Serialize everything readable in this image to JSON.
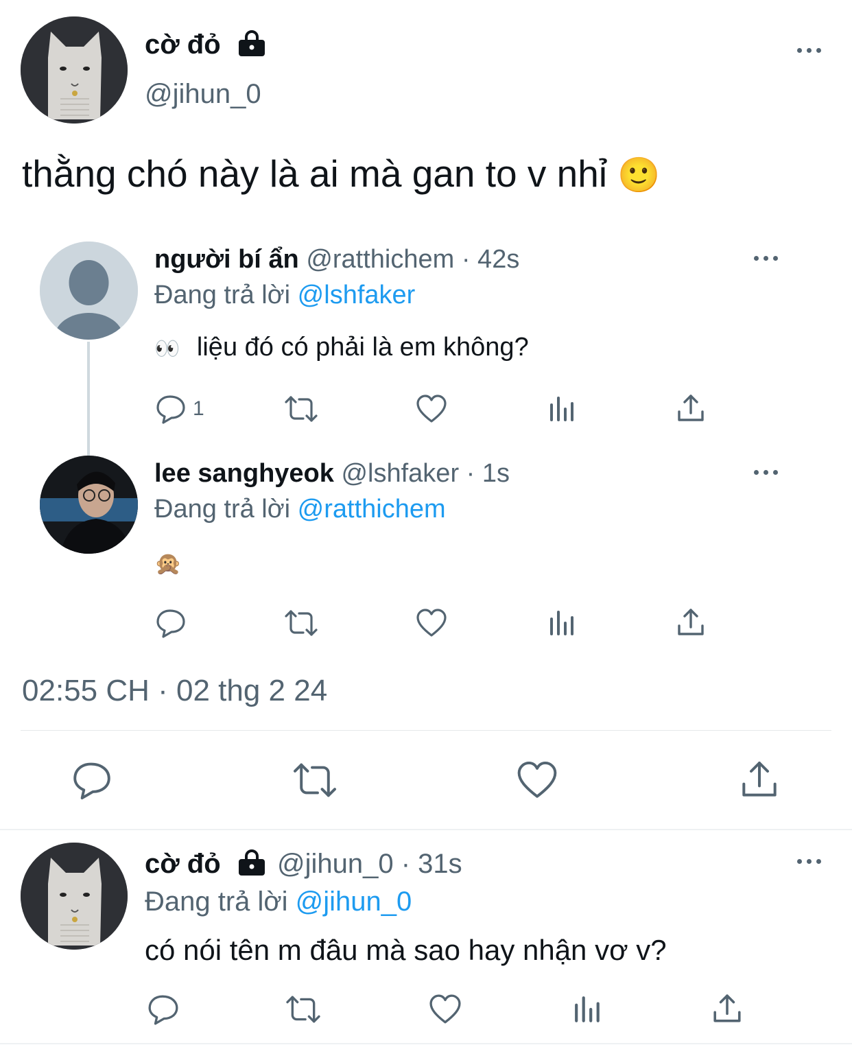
{
  "main_tweet": {
    "display_name": "cờ đỏ",
    "handle": "@jihun_0",
    "text": "thằng chó này là ai mà gan to v nhỉ",
    "emoji": "🙂",
    "timestamp": "02:55 CH · 02 thg 2 24"
  },
  "quoted_thread": [
    {
      "display_name": "người bí ẩn",
      "meta": "@ratthichem · 42s",
      "reply_prefix": "Đang trả lời",
      "reply_to": "@lshfaker",
      "emoji": "👀",
      "text": "liệu đó có phải là em không?",
      "reply_count": "1"
    },
    {
      "display_name": "lee sanghyeok",
      "meta": "@lshfaker · 1s",
      "reply_prefix": "Đang trả lời",
      "reply_to": "@ratthichem",
      "emoji": "🙊",
      "text": "",
      "reply_count": ""
    }
  ],
  "reply_tweet": {
    "display_name": "cờ đỏ",
    "meta": "@jihun_0 · 31s",
    "reply_prefix": "Đang trả lời",
    "reply_to": "@jihun_0",
    "text": "có nói tên m đâu mà sao hay nhận vơ v?"
  },
  "colors": {
    "link": "#1d9bf0",
    "muted": "#536471",
    "text": "#0f1419",
    "divider": "#e6e8ea"
  }
}
